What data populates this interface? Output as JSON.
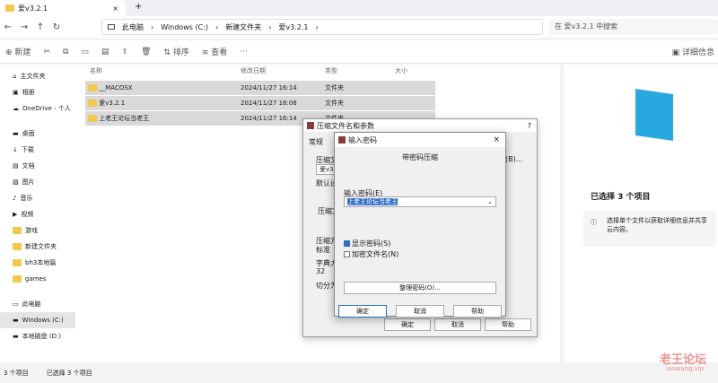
{
  "tab": {
    "title": "爱v3.2.1",
    "close": "×",
    "add": "+"
  },
  "address": {
    "crumbs": [
      "此电脑",
      "Windows (C:)",
      "新建文件夹",
      "爱v3.2.1"
    ],
    "search_placeholder": "在 爱v3.2.1 中搜索"
  },
  "toolbar": {
    "new": "新建",
    "sort": "排序",
    "view": "查看",
    "more": "···",
    "details": "详细信息"
  },
  "sidebar": {
    "items": [
      "主文件夹",
      "相册",
      "OneDrive - 个人",
      "桌面",
      "下载",
      "文档",
      "图片",
      "音乐",
      "视频",
      "游戏",
      "新建文件夹",
      "bh3本地篇",
      "games",
      "此电脑",
      "Windows (C:)",
      "本地磁盘 (D:)"
    ]
  },
  "columns": {
    "name": "名称",
    "date": "修改日期",
    "type": "类型",
    "size": "大小"
  },
  "files": [
    {
      "name": "__MACOSX",
      "date": "2024/11/27 16:14",
      "type": "文件夹"
    },
    {
      "name": "爱v3.2.1",
      "date": "2024/11/27 16:08",
      "type": "文件夹"
    },
    {
      "name": "上老王论坛当老王",
      "date": "2024/11/27 16:14",
      "type": "文件夹"
    }
  ],
  "details": {
    "selected": "已选择 3 个项目",
    "hint": "选择单个文件以获取详细信息并共享云内容。"
  },
  "status": {
    "count": "3 个项目",
    "selected": "已选择 3 个项目"
  },
  "archive_dialog": {
    "title": "压缩文件名和参数",
    "tabs": [
      "常规"
    ],
    "field_label": "压缩文",
    "field_value": "爱v3.2",
    "browse": "(B)...",
    "default_label": "默认设",
    "format_label": "压缩文",
    "method_label": "压缩方",
    "method_value": "标准",
    "dict_label": "字典大",
    "dict_value": "32",
    "split_label": "切分为",
    "ok": "确定",
    "cancel": "取消",
    "help": "帮助",
    "help_icon": "?"
  },
  "password_dialog": {
    "title": "输入密码",
    "subtitle": "带密码压缩",
    "label": "输入密码(E)",
    "value": "上老王论坛当老王",
    "show_pw": "显示密码(S)",
    "encrypt_names": "加密文件名(N)",
    "organize": "整理密码(O)...",
    "ok": "确定",
    "cancel": "取消",
    "help": "帮助"
  },
  "watermark": {
    "line1": "老王论坛",
    "line2": "laowang.vip"
  },
  "colors": {
    "accent": "#0067c0",
    "selection": "#d9d9d9",
    "highlight": "#2f6ec6"
  }
}
